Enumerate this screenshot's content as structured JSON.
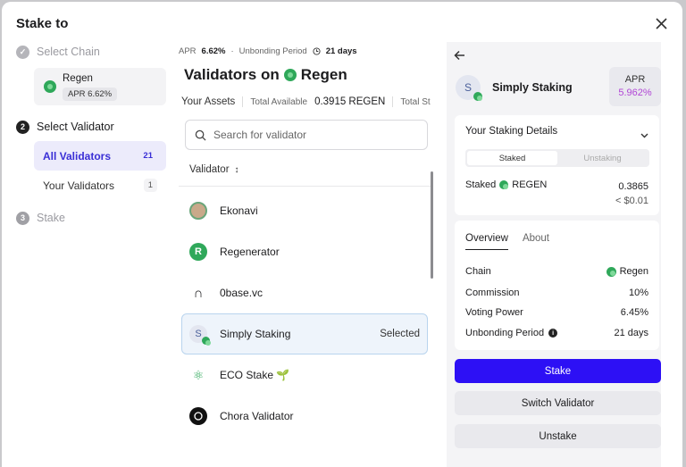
{
  "modal": {
    "title": "Stake to"
  },
  "steps": [
    {
      "number": "✓",
      "label": "Select Chain"
    },
    {
      "number": "2",
      "label": "Select Validator"
    },
    {
      "number": "3",
      "label": "Stake"
    }
  ],
  "chain_card": {
    "name": "Regen",
    "apr": "APR 6.62%"
  },
  "filters": [
    {
      "label": "All Validators",
      "count": "21"
    },
    {
      "label": "Your Validators",
      "count": "1"
    }
  ],
  "meta": {
    "apr_label": "APR",
    "apr_value": "6.62%",
    "dot": "·",
    "unbonding_label": "Unbonding Period",
    "unbonding_value": "21 days"
  },
  "heading": {
    "prefix": "Validators on",
    "chain": "Regen"
  },
  "assets": {
    "label": "Your Assets",
    "available_label": "Total Available",
    "available_value": "0.3915 REGEN",
    "staked_label": "Total St"
  },
  "search": {
    "placeholder": "Search for validator",
    "value": ""
  },
  "table": {
    "column": "Validator",
    "sort_icon": "↕"
  },
  "validators": [
    {
      "name": "Ekonavi",
      "icon": "ekonavi-icon",
      "selected_label": ""
    },
    {
      "name": "Regenerator",
      "icon": "regenerator-icon",
      "selected_label": ""
    },
    {
      "name": "0base.vc",
      "icon": "0base-icon",
      "selected_label": ""
    },
    {
      "name": "Simply Staking",
      "icon": "simply-staking-icon",
      "selected_label": "Selected"
    },
    {
      "name": "ECO Stake 🌱",
      "icon": "eco-stake-icon",
      "selected_label": ""
    },
    {
      "name": "Chora Validator",
      "icon": "chora-icon",
      "selected_label": ""
    }
  ],
  "detail": {
    "name": "Simply Staking",
    "initial": "S",
    "apr_label": "APR",
    "apr_value": "5.962%",
    "staking_details_title": "Your Staking Details",
    "segments": [
      "Staked",
      "Unstaking"
    ],
    "staked_label": "Staked",
    "staked_token": "REGEN",
    "staked_amount": "0.3865",
    "staked_usd": "< $0.01",
    "tabs": [
      "Overview",
      "About"
    ],
    "overview": [
      {
        "key": "Chain",
        "value": "Regen"
      },
      {
        "key": "Commission",
        "value": "10%"
      },
      {
        "key": "Voting Power",
        "value": "6.45%"
      },
      {
        "key": "Unbonding Period",
        "value": "21 days"
      }
    ],
    "buttons": {
      "stake": "Stake",
      "switch": "Switch Validator",
      "unstake": "Unstake"
    }
  },
  "colors": {
    "accent": "#2d10f5",
    "apr_purple": "#b146d6",
    "regen_green": "#2fa85a",
    "selected_bg": "#eef4fb"
  }
}
